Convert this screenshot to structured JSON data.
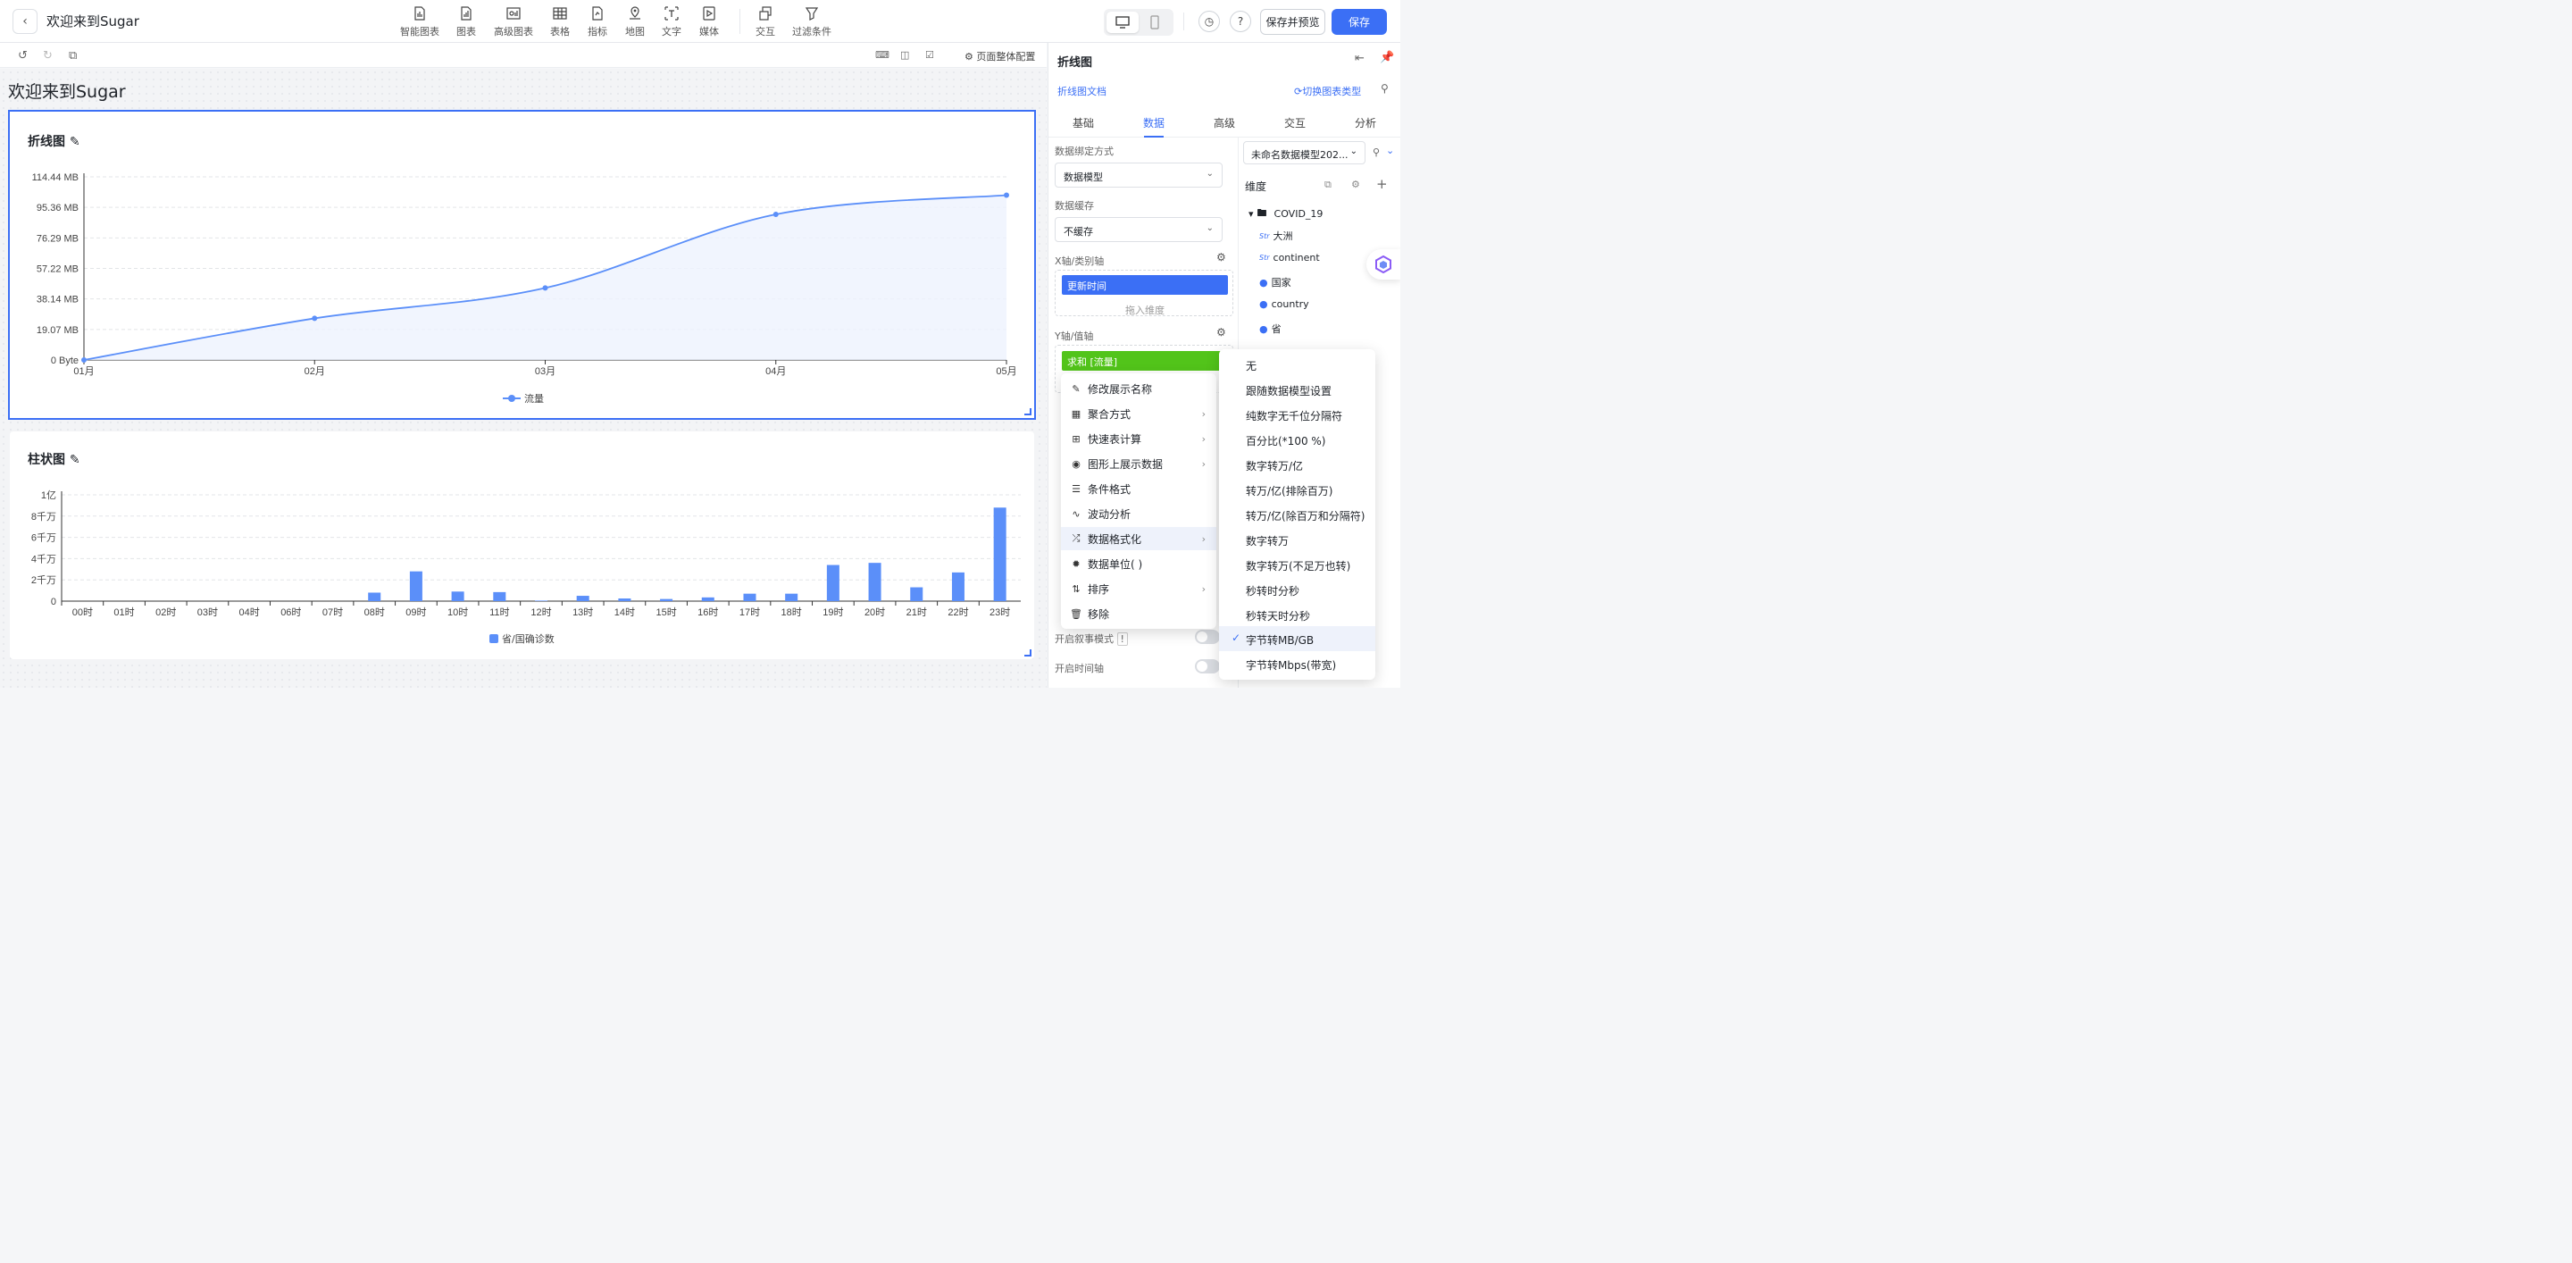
{
  "app": {
    "title": "欢迎来到Sugar",
    "back_icon": "chevron-left-icon"
  },
  "toolbar": [
    {
      "label": "智能图表",
      "icon": "smart-chart-icon"
    },
    {
      "label": "图表",
      "icon": "chart-icon"
    },
    {
      "label": "高级图表",
      "icon": "advanced-chart-icon"
    },
    {
      "label": "表格",
      "icon": "table-icon"
    },
    {
      "label": "指标",
      "icon": "metric-icon"
    },
    {
      "label": "地图",
      "icon": "map-icon"
    },
    {
      "label": "文字",
      "icon": "text-icon"
    },
    {
      "label": "媒体",
      "icon": "media-icon"
    },
    {
      "label": "交互",
      "icon": "interaction-icon"
    },
    {
      "label": "过滤条件",
      "icon": "filter-icon"
    }
  ],
  "header_actions": {
    "save_preview": "保存并预览",
    "save": "保存",
    "history_icon": "clock-icon",
    "help_icon": "question-icon"
  },
  "subbar": {
    "page_config": "页面整体配置"
  },
  "page": {
    "heading": "欢迎来到Sugar"
  },
  "line_card": {
    "title": "折线图"
  },
  "bar_card": {
    "title": "柱状图"
  },
  "chart_data": [
    {
      "type": "line",
      "title": "折线图",
      "categories": [
        "01月",
        "02月",
        "03月",
        "04月",
        "05月"
      ],
      "y_tick_labels": [
        "0 Byte",
        "19.07 MB",
        "38.14 MB",
        "57.22 MB",
        "76.29 MB",
        "95.36 MB",
        "114.44 MB"
      ],
      "series": [
        {
          "name": "流量",
          "values": [
            0,
            26,
            45,
            91,
            103
          ]
        }
      ],
      "ylim": [
        0,
        114.44
      ],
      "ylabel": "",
      "xlabel": "",
      "legend": "bottom-center",
      "grid": true,
      "color": "#5b8ff9"
    },
    {
      "type": "bar",
      "title": "柱状图",
      "categories": [
        "00时",
        "01时",
        "02时",
        "03时",
        "04时",
        "06时",
        "07时",
        "08时",
        "09时",
        "10时",
        "11时",
        "12时",
        "13时",
        "14时",
        "15时",
        "16时",
        "17时",
        "18时",
        "19时",
        "20时",
        "21时",
        "22时",
        "23时"
      ],
      "y_tick_labels": [
        "0",
        "2千万",
        "4千万",
        "6千万",
        "8千万",
        "1亿"
      ],
      "series": [
        {
          "name": "省/国确诊数",
          "values": [
            0,
            0,
            0,
            0,
            0,
            0,
            0,
            0.8,
            2.8,
            0.9,
            0.85,
            0.05,
            0.5,
            0.25,
            0.2,
            0.35,
            0.7,
            0.7,
            3.4,
            3.6,
            1.3,
            2.7,
            8.8
          ]
        }
      ],
      "ylim": [
        0,
        10
      ],
      "ylabel": "",
      "xlabel": "",
      "legend": "bottom-center",
      "grid": true,
      "color": "#5b8ff9"
    }
  ],
  "right_panel": {
    "title": "折线图",
    "doc_link": "折线图文档",
    "switch_type": "切换图表类型",
    "tabs": [
      "基础",
      "数据",
      "高级",
      "交互",
      "分析"
    ],
    "active_tab": "数据",
    "binding_label": "数据绑定方式",
    "binding_value": "数据模型",
    "cache_label": "数据缓存",
    "cache_value": "不缓存",
    "x_axis_label": "X轴/类别轴",
    "x_field": "更新时间",
    "drop_hint": "拖入维度",
    "y_axis_label": "Y轴/值轴",
    "y_field": "求和           [流量]",
    "story_mode": "开启叙事模式",
    "time_axis": "开启时间轴",
    "model_name": "未命名数据模型202...",
    "dimension_header": "维度",
    "dataset": "COVID_19",
    "fields": [
      {
        "label": "大洲",
        "kind": "Str"
      },
      {
        "label": "continent",
        "kind": "Str"
      },
      {
        "label": "国家",
        "kind": "geo"
      },
      {
        "label": "country",
        "kind": "geo"
      },
      {
        "label": "省",
        "kind": "geo"
      }
    ]
  },
  "context_menu": [
    {
      "label": "修改展示名称",
      "icon": "edit-icon",
      "submenu": false
    },
    {
      "label": "聚合方式",
      "icon": "calculator-icon",
      "submenu": true
    },
    {
      "label": "快速表计算",
      "icon": "plus-square-icon",
      "submenu": true
    },
    {
      "label": "图形上展示数据",
      "icon": "eye-icon",
      "submenu": true
    },
    {
      "label": "条件格式",
      "icon": "list-icon",
      "submenu": false
    },
    {
      "label": "波动分析",
      "icon": "pulse-icon",
      "submenu": false
    },
    {
      "label": "数据格式化",
      "icon": "shuffle-icon",
      "submenu": true
    },
    {
      "label": "数据单位( )",
      "icon": "gear-badge-icon",
      "submenu": false
    },
    {
      "label": "排序",
      "icon": "sort-icon",
      "submenu": true
    },
    {
      "label": "移除",
      "icon": "trash-icon",
      "submenu": false
    }
  ],
  "format_submenu": {
    "items": [
      "无",
      "跟随数据模型设置",
      "纯数字无千位分隔符",
      "百分比(*100 %)",
      "数字转万/亿",
      "转万/亿(排除百万)",
      "转万/亿(除百万和分隔符)",
      "数字转万",
      "数字转万(不足万也转)",
      "秒转时分秒",
      "秒转天时分秒",
      "字节转MB/GB",
      "字节转Mbps(带宽)"
    ],
    "selected": "字节转MB/GB"
  }
}
